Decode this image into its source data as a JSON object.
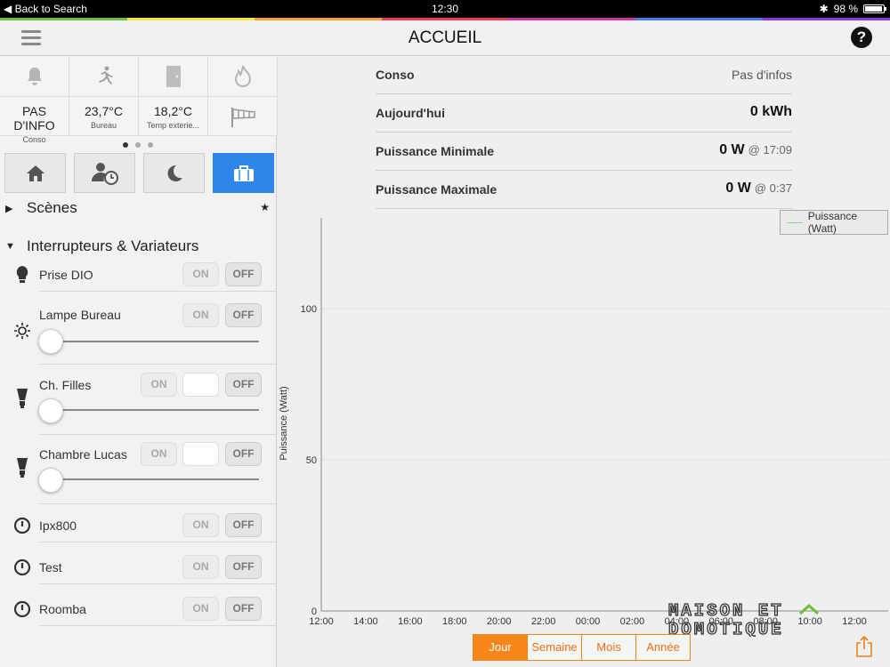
{
  "statusbar": {
    "back": "Back to Search",
    "time": "12:30",
    "battery": "98 %",
    "rainbow": [
      "#6fc04a",
      "#f4e641",
      "#f0a040",
      "#e8405a",
      "#c43aa0",
      "#4a7ce6",
      "#8a3ad8"
    ]
  },
  "navbar": {
    "title": "ACCUEIL",
    "help": "?"
  },
  "tiles": [
    {
      "icon": "bell-icon",
      "value": "PAS D'INFO",
      "label": "Conso"
    },
    {
      "icon": "running-man-icon",
      "value": "23,7°C",
      "label": "Bureau"
    },
    {
      "icon": "door-icon",
      "value": "18,2°C",
      "label": "Temp exterie..."
    },
    {
      "icon": "flame-icon",
      "value": "",
      "label": ""
    }
  ],
  "modes": [
    {
      "name": "home-icon",
      "active": false
    },
    {
      "name": "person-clock-icon",
      "active": false
    },
    {
      "name": "moon-icon",
      "active": false
    },
    {
      "name": "briefcase-icon",
      "active": true
    }
  ],
  "sections": {
    "scenes": "Scènes",
    "switches": "Interrupteurs & Variateurs",
    "star": "★"
  },
  "devices": [
    {
      "name": "Prise DIO",
      "on": "ON",
      "off": "OFF"
    },
    {
      "name": "Lampe Bureau",
      "on": "ON",
      "off": "OFF",
      "level": 0
    },
    {
      "name": "Ch. Filles",
      "on": "ON",
      "off": "OFF",
      "level": 0
    },
    {
      "name": "Chambre Lucas",
      "on": "ON",
      "off": "OFF",
      "level": 0
    },
    {
      "name": "Ipx800",
      "on": "ON",
      "off": "OFF"
    },
    {
      "name": "Test",
      "on": "ON",
      "off": "OFF"
    },
    {
      "name": "Roomba",
      "on": "ON",
      "off": "OFF"
    }
  ],
  "info": {
    "conso_label": "Conso",
    "conso_value": "Pas d'infos",
    "today_label": "Aujourd'hui",
    "today_value": "0 kWh",
    "min_label": "Puissance Minimale",
    "min_value": "0 W",
    "min_time": "@ 17:09",
    "max_label": "Puissance Maximale",
    "max_value": "0 W",
    "max_time": "@ 0:37"
  },
  "periods": [
    "Jour",
    "Semaine",
    "Mois",
    "Année"
  ],
  "watermark": {
    "line1": "MAISON ET",
    "line2": "DOMOTIQUE"
  },
  "chart_data": {
    "type": "line",
    "ylabel": "Puissance (Watt)",
    "ylim": [
      0,
      130
    ],
    "yticks": [
      "0",
      "50",
      "100"
    ],
    "x": [
      "12:00",
      "14:00",
      "16:00",
      "18:00",
      "20:00",
      "22:00",
      "00:00",
      "02:00",
      "04:00",
      "06:00",
      "08:00",
      "10:00",
      "12:00"
    ],
    "series": [
      {
        "name": "Puissance (Watt)",
        "values": [],
        "color": "#86d886"
      }
    ],
    "legend": "top-right",
    "grid": true
  }
}
